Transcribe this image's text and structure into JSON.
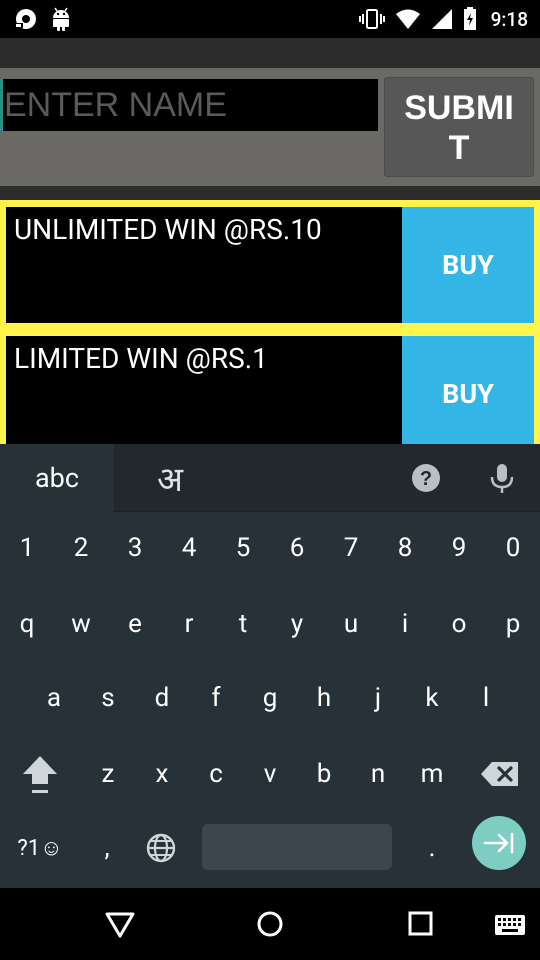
{
  "status_bar": {
    "time": "9:18",
    "left_icons": [
      "screen-record-icon",
      "android-icon"
    ],
    "right_icons": [
      "vibrate-icon",
      "wifi-icon",
      "signal-icon",
      "battery-icon"
    ]
  },
  "form": {
    "name_placeholder": "ENTER NAME",
    "submit_label": "SUBMIT"
  },
  "plans": [
    {
      "description": "UNLIMITED WIN @RS.10",
      "button_label": "BUY"
    },
    {
      "description": "LIMITED WIN @RS.1",
      "button_label": "BUY"
    }
  ],
  "keyboard": {
    "tabs": [
      "abc",
      "अ"
    ],
    "number_row": [
      "1",
      "2",
      "3",
      "4",
      "5",
      "6",
      "7",
      "8",
      "9",
      "0"
    ],
    "row1": [
      "q",
      "w",
      "e",
      "r",
      "t",
      "y",
      "u",
      "i",
      "o",
      "p"
    ],
    "row2": [
      "a",
      "s",
      "d",
      "f",
      "g",
      "h",
      "j",
      "k",
      "l"
    ],
    "row3": [
      "z",
      "x",
      "c",
      "v",
      "b",
      "n",
      "m"
    ],
    "symbols_label": "?1☺",
    "comma": ",",
    "period": ".",
    "icons": [
      "help-icon",
      "mic-icon",
      "shift-icon",
      "backspace-icon",
      "globe-icon",
      "enter-icon"
    ]
  },
  "nav_bar": {
    "icons": [
      "back-icon",
      "home-icon",
      "recents-icon",
      "keyboard-switch-icon"
    ]
  },
  "colors": {
    "accent_yellow": "#fff34c",
    "buy_blue": "#33b5e5",
    "keyboard_bg": "#263238",
    "enter_teal": "#7ecdc3",
    "submit_gray": "#575757"
  }
}
